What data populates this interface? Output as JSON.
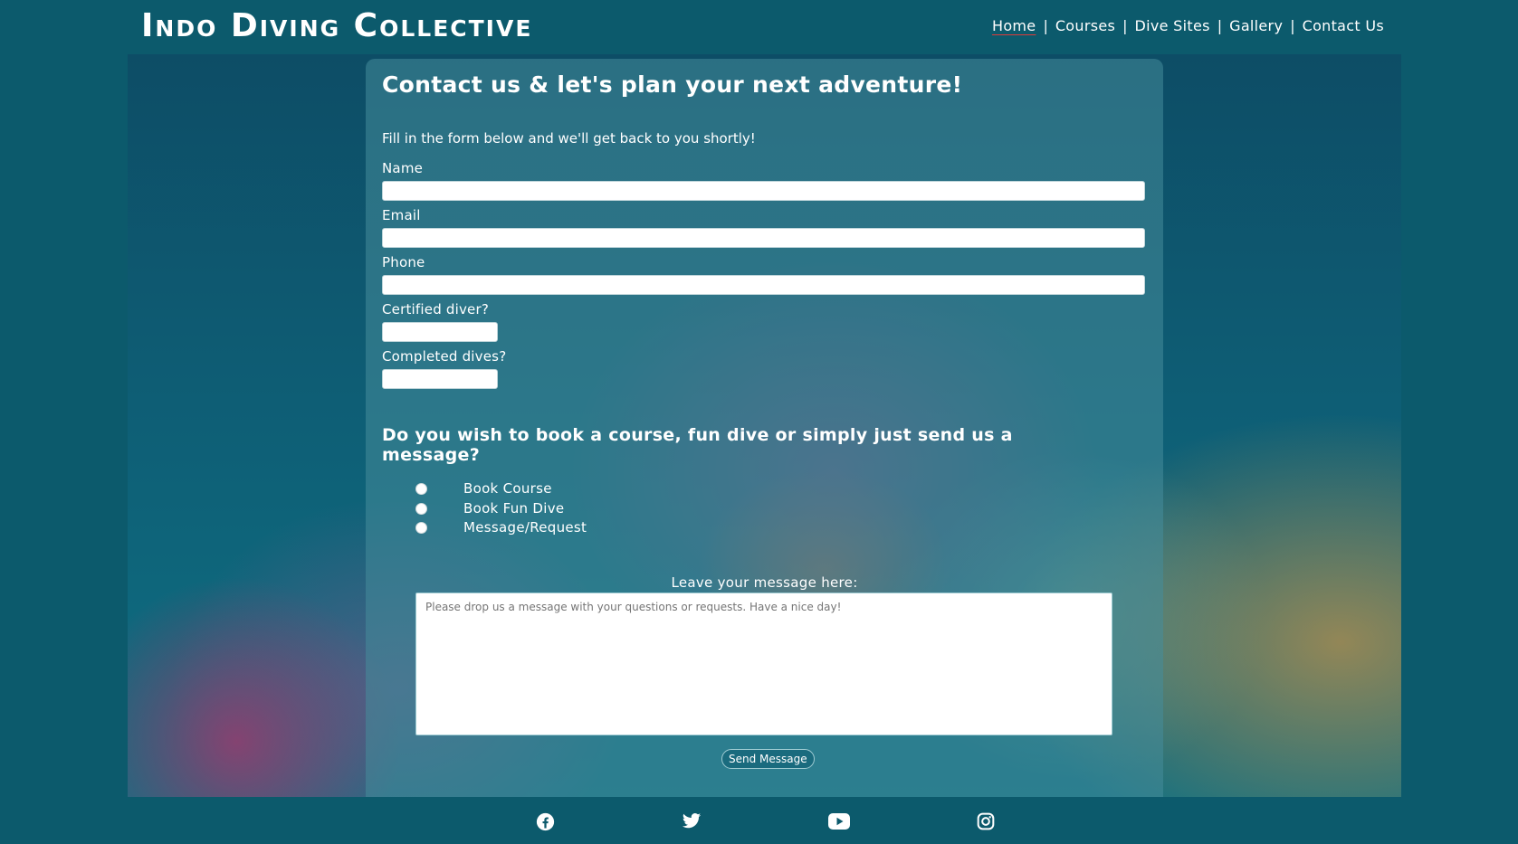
{
  "header": {
    "brand": "Indo Diving Collective",
    "nav": [
      "Home",
      "Courses",
      "Dive Sites",
      "Gallery",
      "Contact Us"
    ],
    "separator": "|"
  },
  "contact": {
    "title": "Contact us & let's plan your next adventure!",
    "intro": "Fill in the form below and we'll get back to you shortly!",
    "fields": {
      "name_label": "Name",
      "email_label": "Email",
      "phone_label": "Phone",
      "certified_label": "Certified diver?",
      "dives_label": "Completed dives?"
    },
    "booking_question": "Do you wish to book a course, fun dive or simply just send us a message?",
    "options": [
      "Book Course",
      "Book Fun Dive",
      "Message/Request"
    ],
    "message_label": "Leave your message here:",
    "message_placeholder": "Please drop us a message with your questions or requests. Have a nice day!",
    "send_label": "Send Message"
  },
  "footer": {
    "social_icons": [
      "facebook-icon",
      "twitter-icon",
      "youtube-icon",
      "instagram-icon"
    ]
  },
  "colors": {
    "header_bg": "#0c5a6c",
    "panel_bg": "rgba(70,140,155,0.55)",
    "accent_underline": "#e03a3a"
  }
}
